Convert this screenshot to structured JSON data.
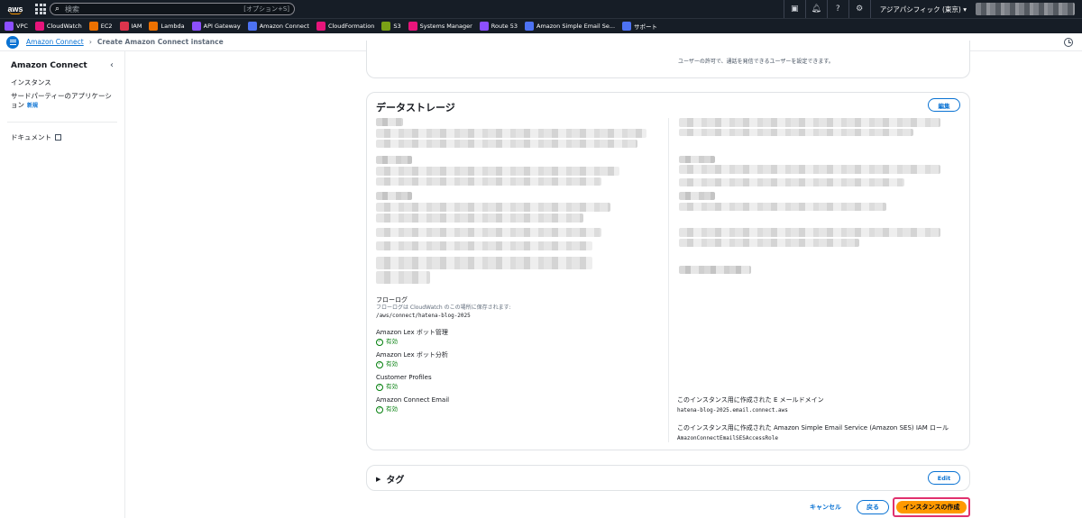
{
  "topnav": {
    "logo": "aws",
    "search_placeholder": "検索",
    "search_hint": "[オプション+S]",
    "region": "アジアパシフィック (東京) ▾"
  },
  "favorites": [
    {
      "label": "VPC",
      "color": "#8c4fff"
    },
    {
      "label": "CloudWatch",
      "color": "#e7157b"
    },
    {
      "label": "EC2",
      "color": "#ed7100"
    },
    {
      "label": "IAM",
      "color": "#dd344c"
    },
    {
      "label": "Lambda",
      "color": "#ed7100"
    },
    {
      "label": "API Gateway",
      "color": "#8c4fff"
    },
    {
      "label": "Amazon Connect",
      "color": "#4d72f3"
    },
    {
      "label": "CloudFormation",
      "color": "#e7157b"
    },
    {
      "label": "S3",
      "color": "#7aa116"
    },
    {
      "label": "Systems Manager",
      "color": "#e7157b"
    },
    {
      "label": "Route 53",
      "color": "#8c4fff"
    },
    {
      "label": "Amazon Simple Email Se...",
      "color": "#4d72f3"
    },
    {
      "label": "サポート",
      "color": "#4d72f3"
    }
  ],
  "breadcrumb": {
    "link": "Amazon Connect",
    "current": "Create Amazon Connect instance"
  },
  "sidebar": {
    "title": "Amazon Connect",
    "items": [
      "インスタンス",
      "サードパーティーのアプリケーション"
    ],
    "new_badge": "新規",
    "docs": "ドキュメント"
  },
  "top_card": {
    "note": "ユーザーの許可で、通話を発信できるユーザーを設定できます。"
  },
  "storage": {
    "title": "データストレージ",
    "edit": "編集",
    "flow_logs_label": "フローログ",
    "flow_logs_sub": "フローログは CloudWatch のこの場所に保存されます:",
    "flow_logs_value": "/aws/connect/hatena-blog-2025",
    "lex_mgmt_label": "Amazon Lex ボット管理",
    "lex_analytics_label": "Amazon Lex ボット分析",
    "profiles_label": "Customer Profiles",
    "email_label": "Amazon Connect Email",
    "enabled": "有効",
    "email_domain_label": "このインスタンス用に作成された E メールドメイン",
    "email_domain_value": "hatena-blog-2025.email.connect.aws",
    "ses_role_label": "このインスタンス用に作成された Amazon Simple Email Service (Amazon SES) IAM ロール",
    "ses_role_value": "AmazonConnectEmailSESAccessRole"
  },
  "tags": {
    "title": "タグ",
    "edit": "Edit"
  },
  "actions": {
    "cancel": "キャンセル",
    "back": "戻る",
    "create": "インスタンスの作成"
  }
}
